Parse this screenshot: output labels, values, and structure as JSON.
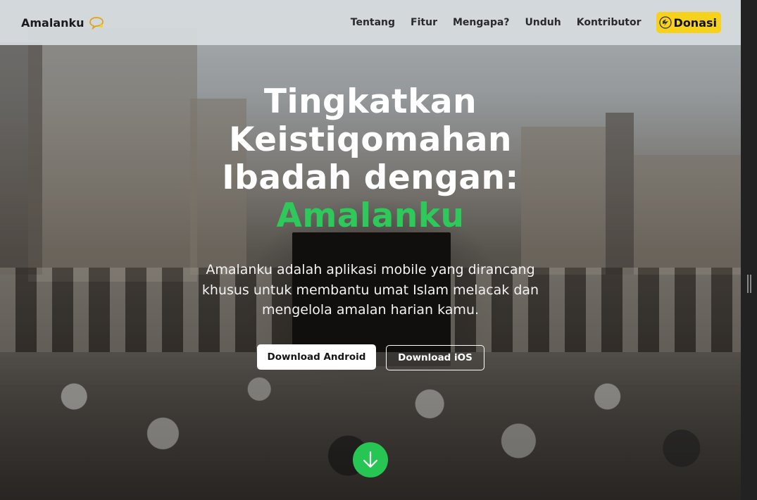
{
  "navbar": {
    "brand": "Amalanku",
    "links": [
      {
        "label": "Tentang"
      },
      {
        "label": "Fitur"
      },
      {
        "label": "Mengapa?"
      },
      {
        "label": "Unduh"
      },
      {
        "label": "Kontributor"
      }
    ],
    "donate_label": "Donasi"
  },
  "hero": {
    "title_lines": [
      "Tingkatkan",
      "Keistiqomahan",
      "Ibadah dengan:"
    ],
    "title_accent": "Amalanku",
    "description": "Amalanku adalah aplikasi mobile yang dirancang khusus untuk membantu umat Islam melacak dan mengelola amalan harian kamu.",
    "android_button": "Download Android",
    "ios_button": "Download iOS"
  },
  "colors": {
    "accent_green": "#2ec95a",
    "donate_yellow": "#f7d21c",
    "navbar_bg": "#d6dbdf"
  },
  "icons": {
    "brand": "speech-bubble-icon",
    "donate": "saweria-icon",
    "scroll": "arrow-down-icon"
  }
}
